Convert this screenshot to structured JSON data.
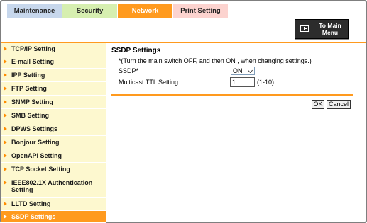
{
  "tabs": [
    {
      "label": "Maintenance"
    },
    {
      "label": "Security"
    },
    {
      "label": "Network"
    },
    {
      "label": "Print Setting"
    }
  ],
  "active_tab": "Network",
  "main_menu": {
    "label": "To Main Menu",
    "icon": "main-menu-icon"
  },
  "sidebar": {
    "items": [
      {
        "label": "TCP/IP Setting"
      },
      {
        "label": "E-mail Setting"
      },
      {
        "label": "IPP Setting"
      },
      {
        "label": "FTP Setting"
      },
      {
        "label": "SNMP Setting"
      },
      {
        "label": "SMB Setting"
      },
      {
        "label": "DPWS Settings"
      },
      {
        "label": "Bonjour Setting"
      },
      {
        "label": "OpenAPI Setting"
      },
      {
        "label": "TCP Socket Setting"
      },
      {
        "label": "IEEE802.1X Authentication Setting"
      },
      {
        "label": "LLTD Setting"
      },
      {
        "label": "SSDP Settings"
      }
    ],
    "active": "SSDP Settings"
  },
  "main": {
    "title": "SSDP Settings",
    "note": "*(Turn the main switch OFF, and then ON , when changing settings.)",
    "ssdp_label": "SSDP*",
    "ssdp_value": "ON",
    "ttl_label": "Multicast TTL Setting",
    "ttl_value": "1",
    "ttl_range": "(1-10)",
    "ok_label": "OK",
    "cancel_label": "Cancel"
  },
  "colors": {
    "accent": "#ff9a1e",
    "sidebar_bg": "#fdf8cf"
  }
}
